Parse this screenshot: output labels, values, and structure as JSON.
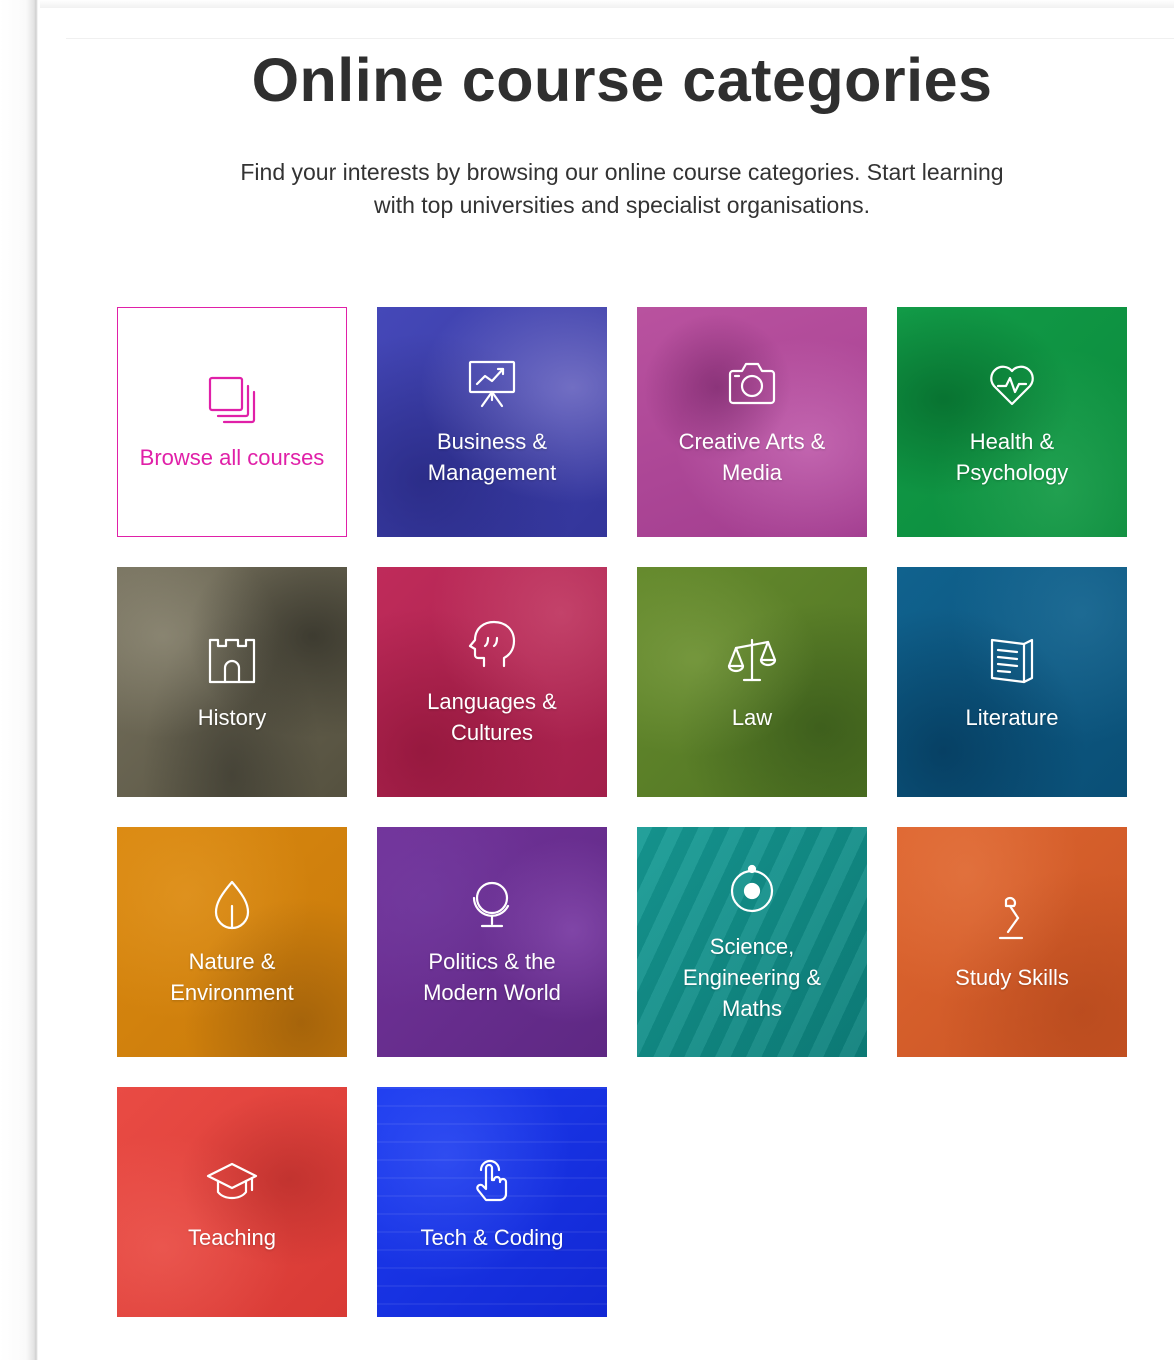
{
  "page": {
    "title": "Online course categories",
    "intro": "Find your interests by browsing our online course categories. Start learning with top universities and specialist organisations."
  },
  "tiles": [
    {
      "label": "Browse all courses",
      "icon": "stacked-squares-icon",
      "color": "#e020a8"
    },
    {
      "label": "Business & Management",
      "icon": "presentation-board-icon",
      "color": "#3d3fad"
    },
    {
      "label": "Creative Arts & Media",
      "icon": "camera-icon",
      "color": "#b3489e"
    },
    {
      "label": "Health & Psychology",
      "icon": "heartbeat-icon",
      "color": "#0f9a45"
    },
    {
      "label": "History",
      "icon": "castle-icon",
      "color": "#6a6656"
    },
    {
      "label": "Languages & Cultures",
      "icon": "speaking-head-icon",
      "color": "#b82553"
    },
    {
      "label": "Law",
      "icon": "scales-icon",
      "color": "#5e822a"
    },
    {
      "label": "Literature",
      "icon": "book-icon",
      "color": "#0e5c86"
    },
    {
      "label": "Nature & Environment",
      "icon": "leaf-icon",
      "color": "#d4820d"
    },
    {
      "label": "Politics & the Modern World",
      "icon": "globe-icon",
      "color": "#6b2f92"
    },
    {
      "label": "Science, Engineering & Maths",
      "icon": "orbit-icon",
      "color": "#12958f"
    },
    {
      "label": "Study Skills",
      "icon": "desk-lamp-icon",
      "color": "#d95f2c"
    },
    {
      "label": "Teaching",
      "icon": "graduation-cap-icon",
      "color": "#e5453f"
    },
    {
      "label": "Tech & Coding",
      "icon": "touch-hand-icon",
      "color": "#1734e6"
    }
  ]
}
